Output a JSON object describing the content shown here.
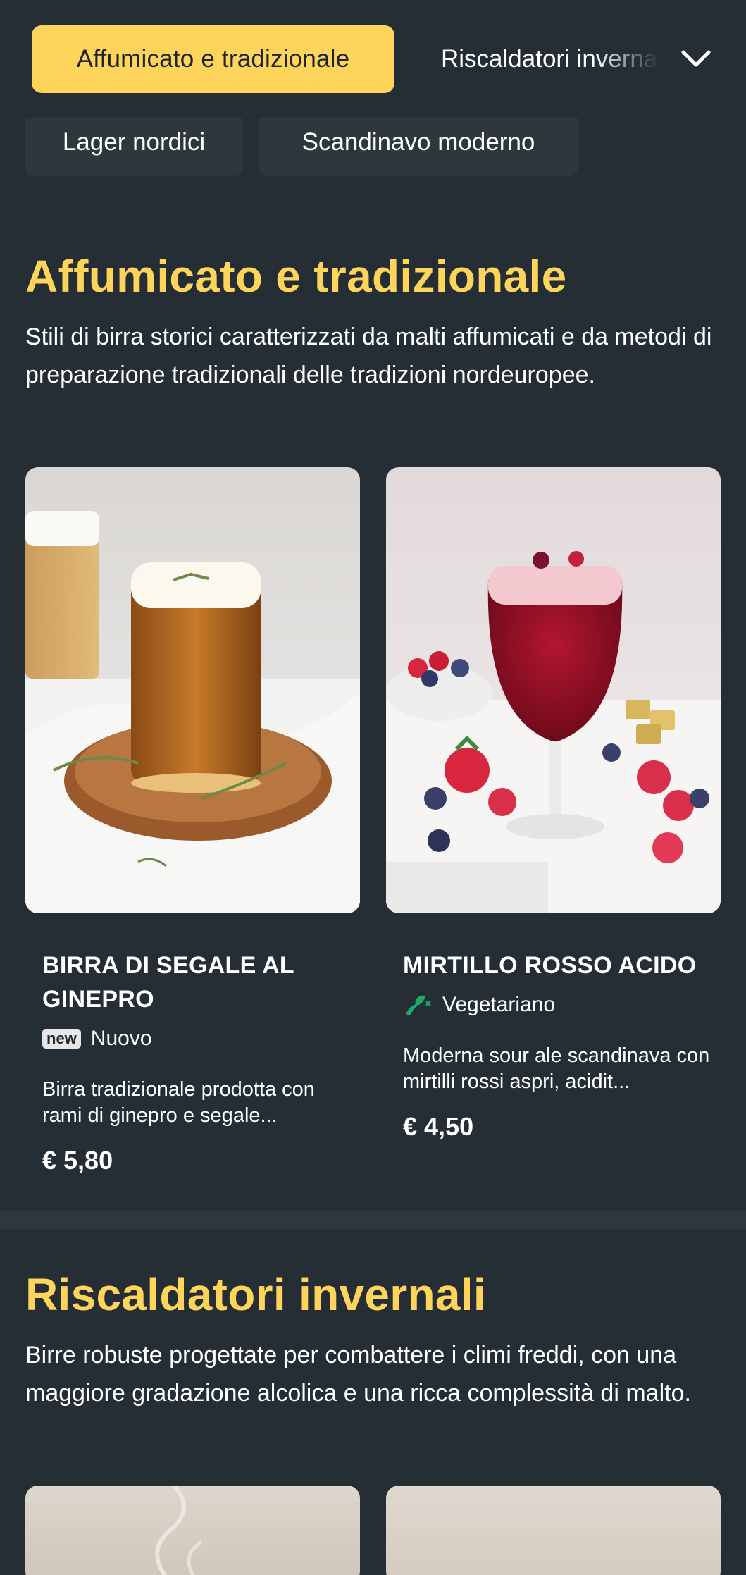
{
  "tabs": {
    "active_label": "Affumicato e tradizionale",
    "next_label": "Riscaldatori invernali",
    "second_row": [
      "Lager nordici",
      "Scandinavo moderno"
    ]
  },
  "sections": [
    {
      "title": "Affumicato e tradizionale",
      "description": "Stili di birra storici caratterizzati da malti affumicati e da metodi di preparazione tradizionali delle tradizioni nordeuropee.",
      "products": [
        {
          "name": "BIRRA DI SEGALE AL GINEPRO",
          "badge_text": "new",
          "badge_label": "Nuovo",
          "description": "Birra tradizionale prodotta con rami di ginepro e segale...",
          "price": "€ 5,80"
        },
        {
          "name": "MIRTILLO ROSSO ACIDO",
          "badge_label": "Vegetariano",
          "description": "Moderna sour ale scandinava con mirtilli rossi aspri, acidit...",
          "price": "€ 4,50"
        }
      ]
    },
    {
      "title": "Riscaldatori invernali",
      "description": "Birre robuste progettate per combattere i climi freddi, con una maggiore gradazione alcolica e una ricca complessità di malto."
    }
  ],
  "colors": {
    "background": "#252e35",
    "accent": "#fed45a",
    "vegetarian": "#1faa6b"
  },
  "icons": [
    "chevron-down-icon",
    "vegetarian-leaf-icon"
  ]
}
